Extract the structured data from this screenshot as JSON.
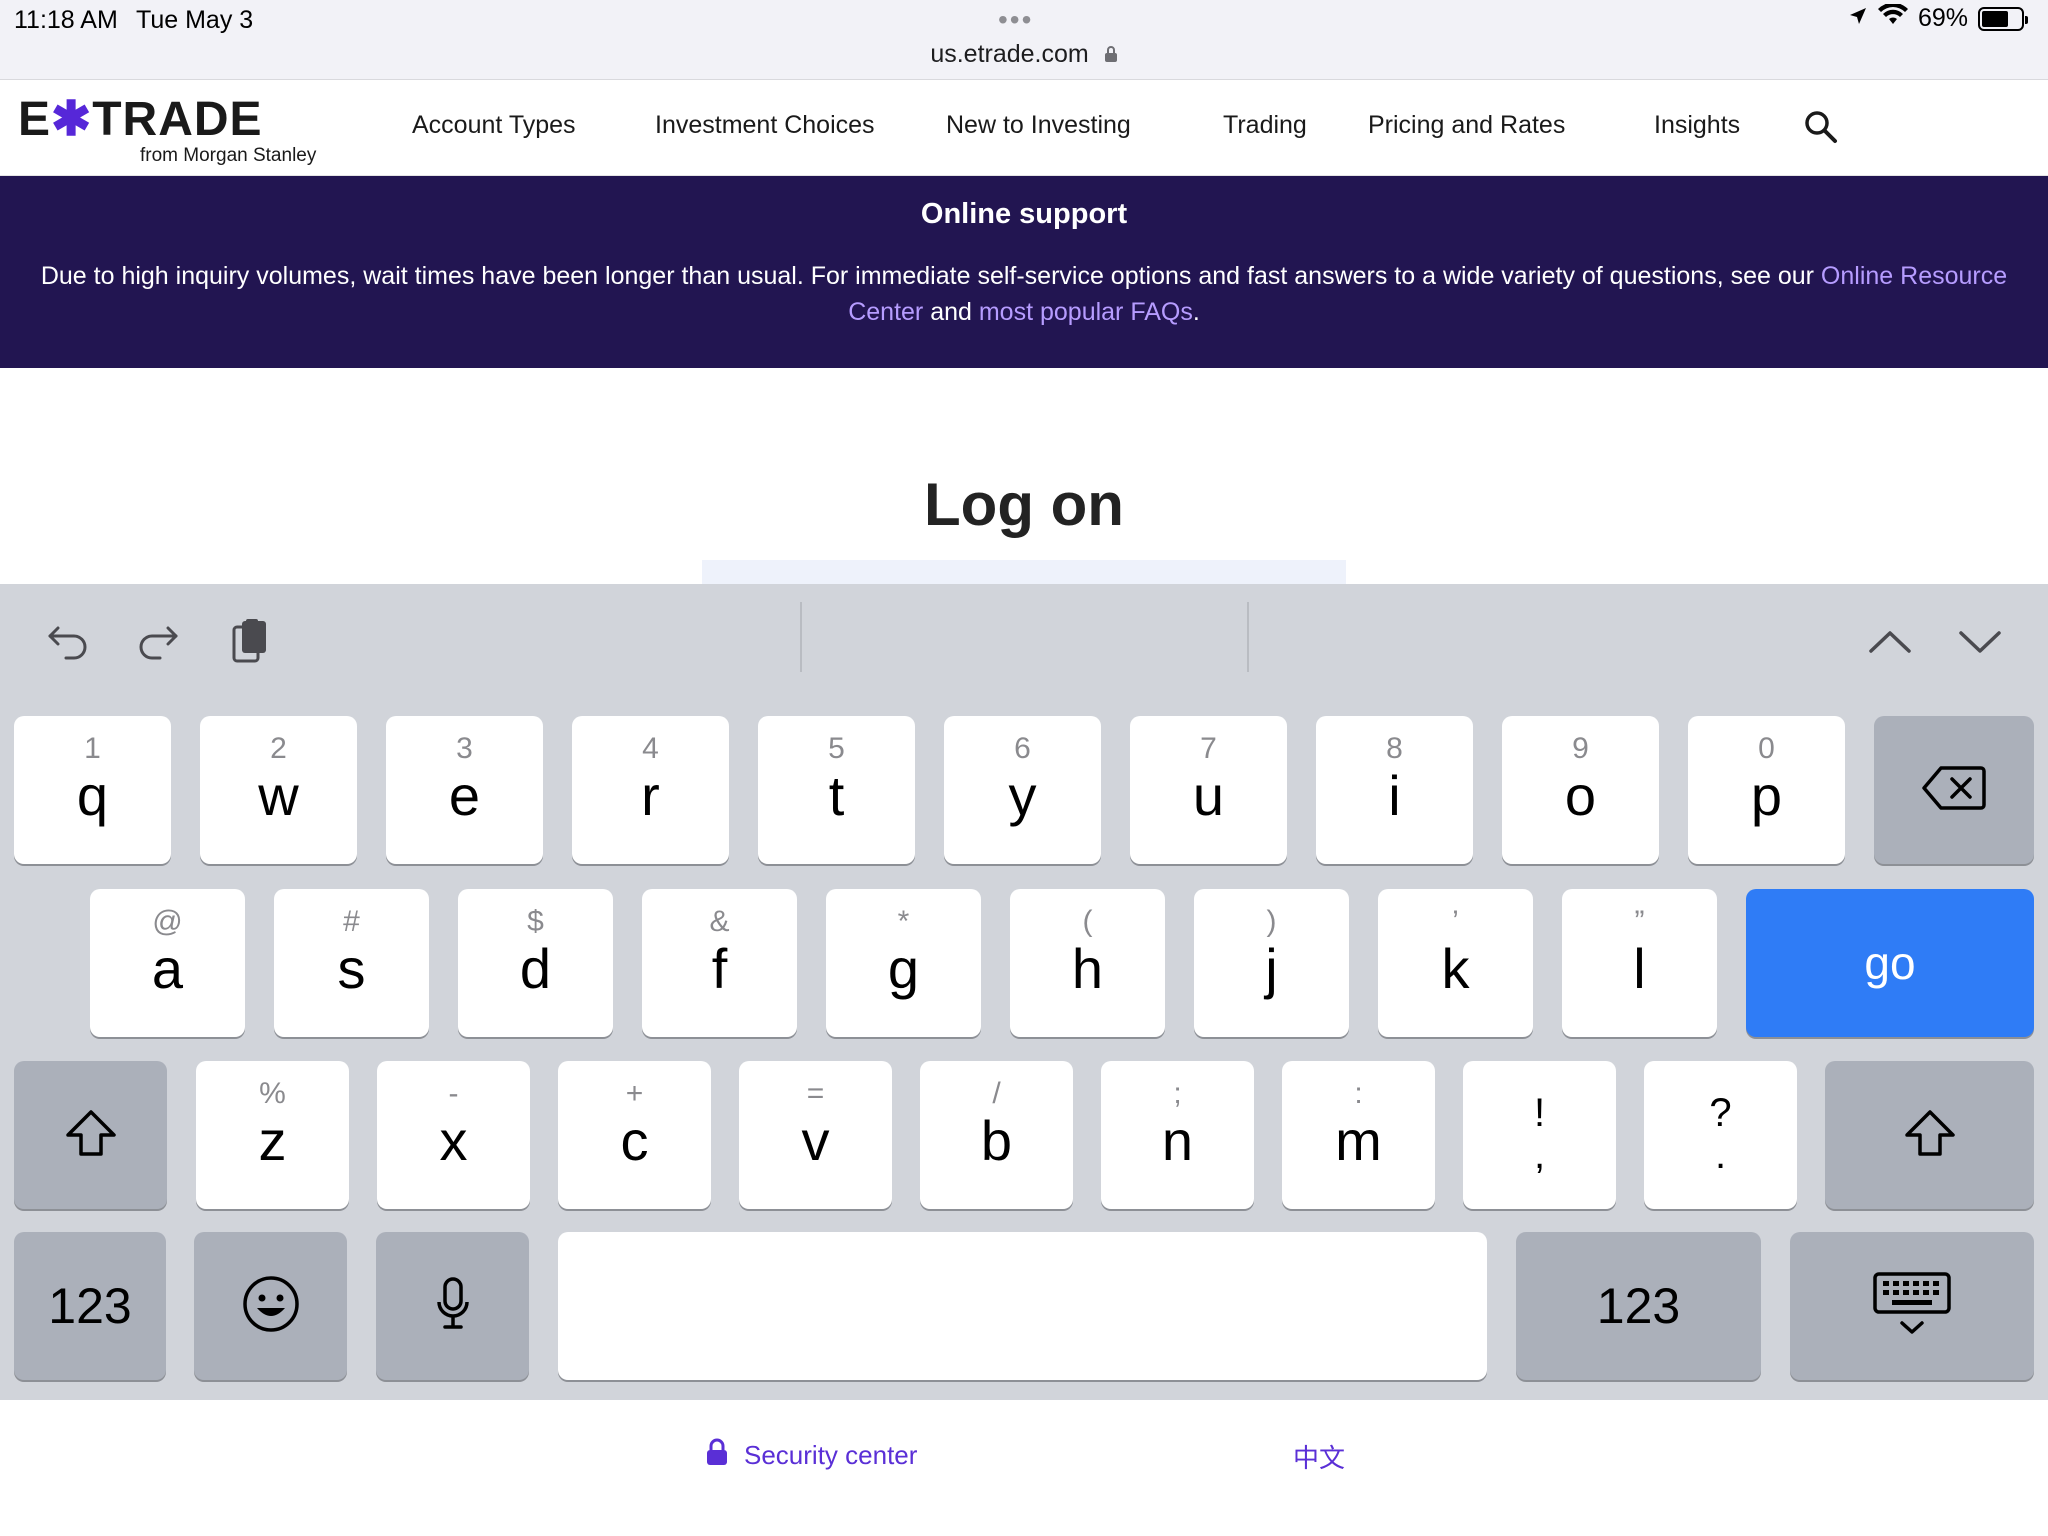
{
  "status_bar": {
    "time": "11:18 AM",
    "date": "Tue May 3",
    "more": "•••",
    "url": "us.etrade.com",
    "battery": "69%",
    "battery_level": 0.69
  },
  "header": {
    "logo_main_left": "E",
    "logo_x": "✱",
    "logo_main_right": "TRADE",
    "logo_sub": "from Morgan Stanley",
    "nav": [
      "Account Types",
      "Investment Choices",
      "New to Investing",
      "Trading",
      "Pricing and Rates",
      "Insights"
    ]
  },
  "banner": {
    "title": "Online support",
    "text_before": "Due to high inquiry volumes, wait times have been longer than usual. For immediate self-service options and fast answers to a wide variety of questions, see our ",
    "link1": "Online Resource Center",
    "text_middle": " and ",
    "link2": "most popular FAQs",
    "text_after": "."
  },
  "login": {
    "title": "Log on"
  },
  "keyboard": {
    "row1": [
      {
        "alt": "1",
        "main": "q"
      },
      {
        "alt": "2",
        "main": "w"
      },
      {
        "alt": "3",
        "main": "e"
      },
      {
        "alt": "4",
        "main": "r"
      },
      {
        "alt": "5",
        "main": "t"
      },
      {
        "alt": "6",
        "main": "y"
      },
      {
        "alt": "7",
        "main": "u"
      },
      {
        "alt": "8",
        "main": "i"
      },
      {
        "alt": "9",
        "main": "o"
      },
      {
        "alt": "0",
        "main": "p"
      }
    ],
    "row2": [
      {
        "alt": "@",
        "main": "a"
      },
      {
        "alt": "#",
        "main": "s"
      },
      {
        "alt": "$",
        "main": "d"
      },
      {
        "alt": "&",
        "main": "f"
      },
      {
        "alt": "*",
        "main": "g"
      },
      {
        "alt": "(",
        "main": "h"
      },
      {
        "alt": ")",
        "main": "j"
      },
      {
        "alt": "’",
        "main": "k"
      },
      {
        "alt": "”",
        "main": "l"
      }
    ],
    "row3": [
      {
        "alt": "%",
        "main": "z"
      },
      {
        "alt": "-",
        "main": "x"
      },
      {
        "alt": "+",
        "main": "c"
      },
      {
        "alt": "=",
        "main": "v"
      },
      {
        "alt": "/",
        "main": "b"
      },
      {
        "alt": ";",
        "main": "n"
      },
      {
        "alt": ":",
        "main": "m"
      }
    ],
    "punct1": {
      "top": "!",
      "bottom": ","
    },
    "punct2": {
      "top": "?",
      "bottom": "."
    },
    "go": "go",
    "numbers_left": "123",
    "numbers_right": "123",
    "space": ""
  },
  "footer": {
    "security": "Security center",
    "language": "中文"
  }
}
